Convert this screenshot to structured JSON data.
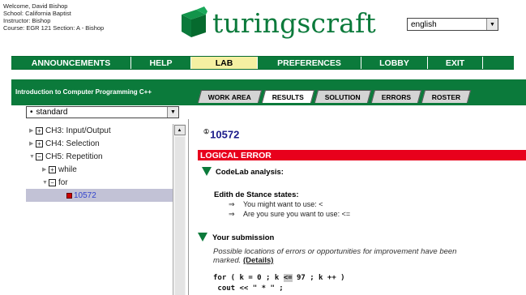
{
  "header": {
    "user_lines": [
      "Welcome, David Bishop",
      "School: California Baptist",
      "Instructor: Bishop",
      "Course: EGR 121 Section: A - Bishop"
    ],
    "logo_text": "turingscraft",
    "language": "english"
  },
  "top_nav": {
    "items": [
      "ANNOUNCEMENTS",
      "HELP",
      "LAB",
      "PREFERENCES",
      "LOBBY",
      "EXIT"
    ],
    "active": "LAB"
  },
  "course_title": "Introduction to Computer Programming C++",
  "tabs": {
    "items": [
      "WORK AREA",
      "RESULTS",
      "SOLUTION",
      "ERRORS",
      "ROSTER"
    ],
    "active": "RESULTS"
  },
  "left_panel": {
    "mode_select": "standard",
    "tree": [
      {
        "label": "CH3: Input/Output",
        "box": "+"
      },
      {
        "label": "CH4: Selection",
        "box": "+"
      },
      {
        "label": "CH5: Repetition",
        "box": "−"
      },
      {
        "label": "while",
        "box": "+"
      },
      {
        "label": "for",
        "box": "−"
      },
      {
        "label": "10572",
        "box": ""
      }
    ]
  },
  "result": {
    "problem_id": "10572",
    "status": "LOGICAL ERROR",
    "analysis_heading": "CodeLab analysis:",
    "states_heading": "Edith de Stance states:",
    "bullets": [
      {
        "arrow": "⇒",
        "text": "You might want to use: <"
      },
      {
        "arrow": "⇒",
        "text": "Are you sure you want to use: <="
      }
    ],
    "submission_heading": "Your submission",
    "note": "Possible locations of errors or opportunities for improvement have been marked.",
    "details_link": "(Details)",
    "code_line1_a": "for ( k = 0 ; k ",
    "code_line1_hl": "<=",
    "code_line1_b": " 97 ; k ++ )",
    "code_line2": " cout << \" * \" ;"
  },
  "colors": {
    "brand_green": "#0b7a3b",
    "error_red": "#e8001c",
    "lab_highlight": "#f5f0a2"
  }
}
